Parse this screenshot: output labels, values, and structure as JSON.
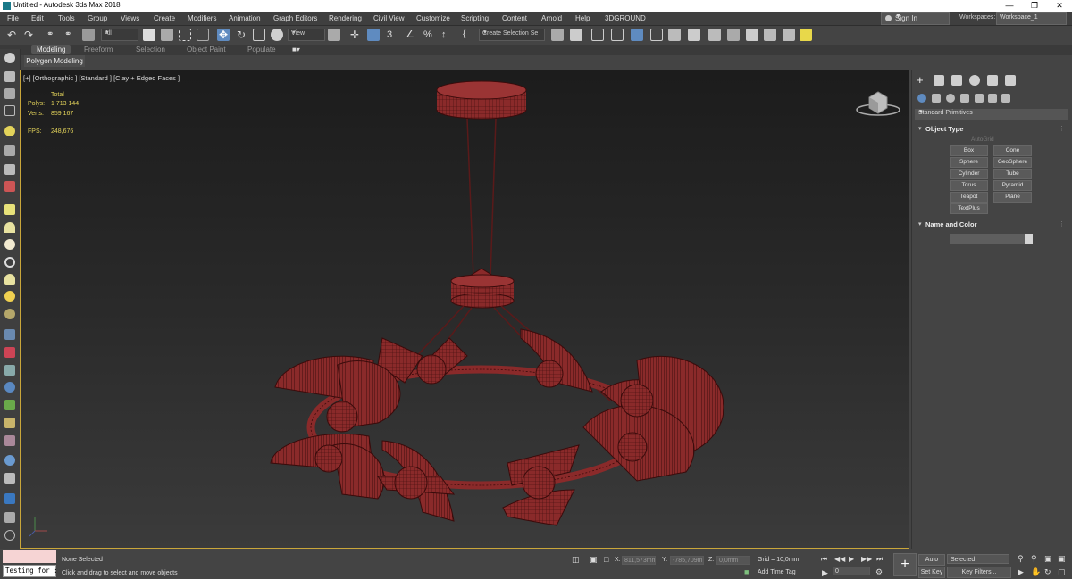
{
  "window": {
    "title": "Untitled - Autodesk 3ds Max 2018"
  },
  "menu": {
    "items": [
      "File",
      "Edit",
      "Tools",
      "Group",
      "Views",
      "Create",
      "Modifiers",
      "Animation",
      "Graph Editors",
      "Rendering",
      "Civil View",
      "Customize",
      "Scripting",
      "Content",
      "Arnold",
      "Help",
      "3DGROUND"
    ]
  },
  "account": {
    "sign_in": "Sign In",
    "workspaces_label": "Workspaces:",
    "workspace": "Workspace_1"
  },
  "toolbar": {
    "filter": "All",
    "ref_coord": "View",
    "selection_set": "Create Selection Se"
  },
  "ribbon": {
    "tabs": [
      "Modeling",
      "Freeform",
      "Selection",
      "Object Paint",
      "Populate"
    ],
    "active_tab": "Modeling",
    "panel_label": "Polygon Modeling"
  },
  "viewport": {
    "label": "[+] [Orthographic ] [Standard ] [Clay + Edged Faces ]",
    "stats": {
      "total_label": "Total",
      "polys_label": "Polys:",
      "polys": "1 713 144",
      "verts_label": "Verts:",
      "verts": "859 167",
      "fps_label": "FPS:",
      "fps": "248,676"
    }
  },
  "command_panel": {
    "category": "Standard Primitives",
    "object_type_title": "Object Type",
    "autogrid": "AutoGrid",
    "primitives": [
      "Box",
      "Cone",
      "Sphere",
      "GeoSphere",
      "Cylinder",
      "Tube",
      "Torus",
      "Pyramid",
      "Teapot",
      "Plane",
      "TextPlus"
    ],
    "name_color_title": "Name and Color"
  },
  "status": {
    "selection": "None Selected",
    "prompt": "Click and drag to select and move objects",
    "maxscript": "Testing for :",
    "x_label": "X:",
    "x": "811,573mm",
    "y_label": "Y:",
    "y": "-785,709m",
    "z_label": "Z:",
    "z": "0,0mm",
    "grid": "Grid = 10,0mm",
    "add_time_tag": "Add Time Tag",
    "auto_key": "Auto Key",
    "set_key": "Set Key",
    "key_mode": "Selected",
    "key_filters": "Key Filters...",
    "frame": "0"
  },
  "colors": {
    "mesh": "#8a2a2a",
    "wire": "#3a0b0b",
    "viewport_border": "#c9a63a",
    "active_blue": "#5f8bc0"
  }
}
